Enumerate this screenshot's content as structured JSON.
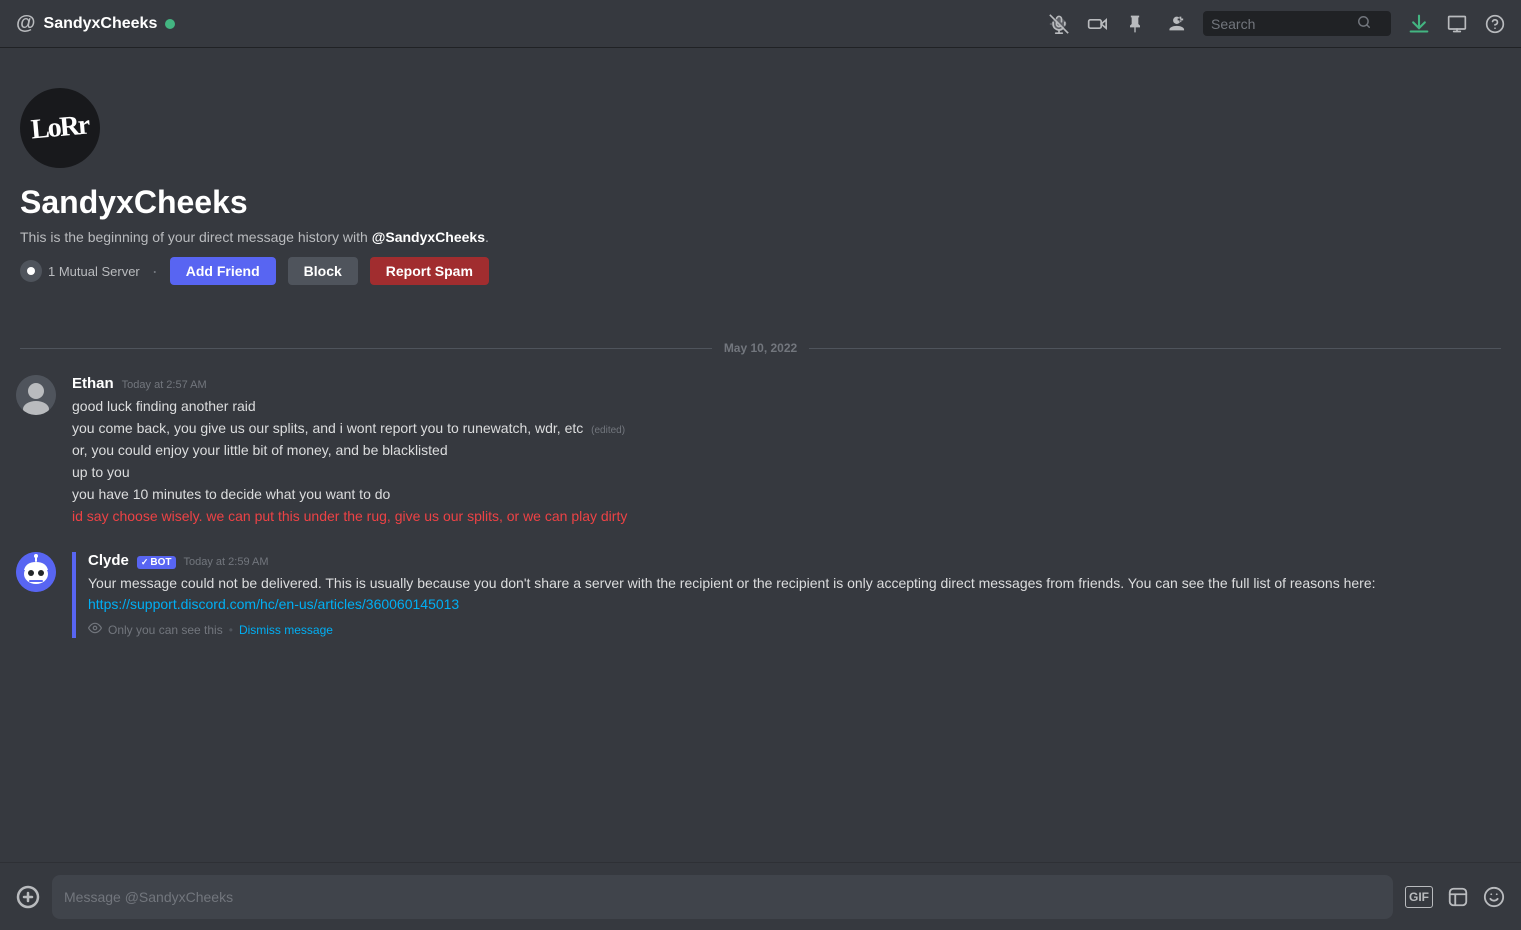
{
  "header": {
    "username": "SandyxCheeks",
    "online": true,
    "search_placeholder": "Search"
  },
  "dm_profile": {
    "avatar_text": "LoRr",
    "name": "SandyxCheeks",
    "description_start": "This is the beginning of your direct message history with ",
    "description_handle": "@SandyxCheeks",
    "description_end": ".",
    "mutual_servers": "1 Mutual Server",
    "btn_add_friend": "Add Friend",
    "btn_block": "Block",
    "btn_report": "Report Spam"
  },
  "date_divider": "May 10, 2022",
  "messages": [
    {
      "id": "ethan-msg",
      "author": "Ethan",
      "timestamp": "Today at 2:57 AM",
      "avatar_type": "ethan",
      "bot": false,
      "lines": [
        {
          "text": "good luck finding another raid",
          "red": false,
          "edited": false
        },
        {
          "text": "you come back, you give us our splits, and i wont report you to runewatch, wdr, etc",
          "red": false,
          "edited": true
        },
        {
          "text": "or, you could enjoy your little bit of money, and be blacklisted",
          "red": false,
          "edited": false
        },
        {
          "text": "up to you",
          "red": false,
          "edited": false
        },
        {
          "text": "you have 10 minutes to decide what you want to do",
          "red": false,
          "edited": false
        },
        {
          "text": "id say choose wisely. we can put this under the rug, give us our splits, or we can play dirty",
          "red": true,
          "edited": false
        }
      ]
    },
    {
      "id": "clyde-msg",
      "author": "Clyde",
      "timestamp": "Today at 2:59 AM",
      "avatar_type": "clyde",
      "bot": true,
      "lines": [
        {
          "text": "Your message could not be delivered. This is usually because you don't share a server with the recipient or the recipient is only accepting direct messages from friends. You can see the full list of reasons here: ",
          "red": false,
          "edited": false,
          "link": "https://support.discord.com/hc/en-us/articles/360060145013"
        }
      ],
      "ephemeral": "Only you can see this",
      "dismiss": "Dismiss message"
    }
  ],
  "bottom": {
    "message_placeholder": ""
  },
  "icons": {
    "voice_mute": "🔇",
    "video": "📹",
    "pin": "📌",
    "add_member": "👤+",
    "search": "🔍",
    "inbox": "⬇",
    "popout": "⊟",
    "help": "❓",
    "plus": "+",
    "gif": "GIF",
    "emoji": "😊",
    "nitro": "✨"
  }
}
